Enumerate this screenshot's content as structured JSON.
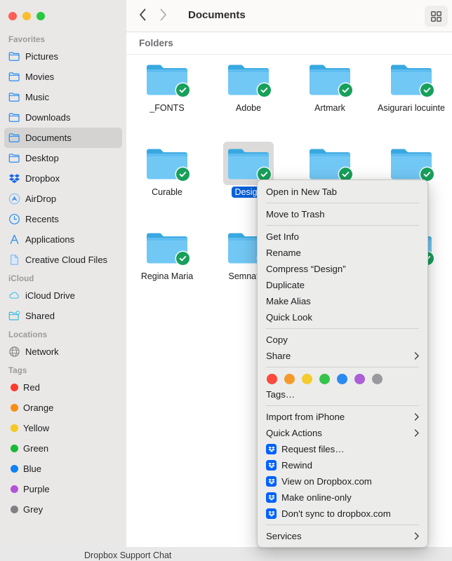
{
  "window": {
    "traffic_lights": [
      "close",
      "minimize",
      "zoom"
    ],
    "toolbar": {
      "back_label": "Back",
      "forward_label": "Forward",
      "title": "Documents",
      "view_button_label": "Icon View"
    },
    "section_header": "Folders"
  },
  "sidebar": {
    "sections": [
      {
        "title": "Favorites",
        "items": [
          {
            "label": "Pictures",
            "icon": "folder-icon",
            "selected": false
          },
          {
            "label": "Movies",
            "icon": "folder-icon",
            "selected": false
          },
          {
            "label": "Music",
            "icon": "folder-icon",
            "selected": false
          },
          {
            "label": "Downloads",
            "icon": "folder-icon",
            "selected": false
          },
          {
            "label": "Documents",
            "icon": "folder-icon",
            "selected": true
          },
          {
            "label": "Desktop",
            "icon": "folder-icon",
            "selected": false
          },
          {
            "label": "Dropbox",
            "icon": "dropbox-icon",
            "selected": false
          },
          {
            "label": "AirDrop",
            "icon": "airdrop-icon",
            "selected": false
          },
          {
            "label": "Recents",
            "icon": "clock-icon",
            "selected": false
          },
          {
            "label": "Applications",
            "icon": "applications-icon",
            "selected": false
          },
          {
            "label": "Creative Cloud Files",
            "icon": "document-icon",
            "selected": false
          }
        ]
      },
      {
        "title": "iCloud",
        "items": [
          {
            "label": "iCloud Drive",
            "icon": "cloud-icon",
            "selected": false
          },
          {
            "label": "Shared",
            "icon": "shared-folder-icon",
            "selected": false
          }
        ]
      },
      {
        "title": "Locations",
        "items": [
          {
            "label": "Network",
            "icon": "globe-icon",
            "selected": false
          }
        ]
      },
      {
        "title": "Tags",
        "items": [
          {
            "label": "Red",
            "icon": "tag-dot",
            "color": "#fc3b2d",
            "selected": false
          },
          {
            "label": "Orange",
            "icon": "tag-dot",
            "color": "#fa8d14",
            "selected": false
          },
          {
            "label": "Yellow",
            "icon": "tag-dot",
            "color": "#f7c81e",
            "selected": false
          },
          {
            "label": "Green",
            "icon": "tag-dot",
            "color": "#16bb35",
            "selected": false
          },
          {
            "label": "Blue",
            "icon": "tag-dot",
            "color": "#1182f5",
            "selected": false
          },
          {
            "label": "Purple",
            "icon": "tag-dot",
            "color": "#b452d8",
            "selected": false
          },
          {
            "label": "Grey",
            "icon": "tag-dot",
            "color": "#808084",
            "selected": false
          }
        ]
      }
    ]
  },
  "folders": [
    {
      "name": "_FONTS",
      "synced": true,
      "selected": false
    },
    {
      "name": "Adobe",
      "synced": true,
      "selected": false
    },
    {
      "name": "Artmark",
      "synced": true,
      "selected": false
    },
    {
      "name": "Asigurari locuinte",
      "synced": true,
      "selected": false
    },
    {
      "name": "Curable",
      "synced": true,
      "selected": false
    },
    {
      "name": "Design",
      "synced": true,
      "selected": true
    },
    {
      "name": "",
      "synced": true,
      "selected": false
    },
    {
      "name": "",
      "synced": true,
      "selected": false
    },
    {
      "name": "Regina Maria",
      "synced": true,
      "selected": false
    },
    {
      "name": "Semnaturi",
      "synced": true,
      "selected": false
    },
    {
      "name": "",
      "synced": true,
      "selected": false
    },
    {
      "name": "",
      "synced": true,
      "selected": false
    }
  ],
  "context_menu": {
    "groups": [
      {
        "items": [
          {
            "label": "Open in New Tab",
            "submenu": false,
            "icon": null
          }
        ]
      },
      {
        "items": [
          {
            "label": "Move to Trash",
            "submenu": false,
            "icon": null
          }
        ]
      },
      {
        "items": [
          {
            "label": "Get Info",
            "submenu": false,
            "icon": null
          },
          {
            "label": "Rename",
            "submenu": false,
            "icon": null
          },
          {
            "label": "Compress “Design”",
            "submenu": false,
            "icon": null
          },
          {
            "label": "Duplicate",
            "submenu": false,
            "icon": null
          },
          {
            "label": "Make Alias",
            "submenu": false,
            "icon": null
          },
          {
            "label": "Quick Look",
            "submenu": false,
            "icon": null
          }
        ]
      },
      {
        "items": [
          {
            "label": "Copy",
            "submenu": false,
            "icon": null
          },
          {
            "label": "Share",
            "submenu": true,
            "icon": null
          }
        ]
      },
      {
        "colors": [
          "#fc4a3b",
          "#f59a2a",
          "#f5cc2e",
          "#35c44b",
          "#2b8af0",
          "#ab5ed6",
          "#9a9a9e"
        ],
        "items": [
          {
            "label": "Tags…",
            "submenu": false,
            "icon": null
          }
        ]
      },
      {
        "items": [
          {
            "label": "Import from iPhone",
            "submenu": true,
            "icon": null
          },
          {
            "label": "Quick Actions",
            "submenu": true,
            "icon": null
          },
          {
            "label": "Request files…",
            "submenu": false,
            "icon": "dropbox-icon"
          },
          {
            "label": "Rewind",
            "submenu": false,
            "icon": "dropbox-icon"
          },
          {
            "label": "View on Dropbox.com",
            "submenu": false,
            "icon": "dropbox-icon"
          },
          {
            "label": "Make online-only",
            "submenu": false,
            "icon": "dropbox-icon"
          },
          {
            "label": "Don't sync to dropbox.com",
            "submenu": false,
            "icon": "dropbox-icon"
          }
        ]
      },
      {
        "items": [
          {
            "label": "Services",
            "submenu": true,
            "icon": null
          }
        ]
      }
    ]
  },
  "desktop": {
    "bottom_label": "Dropbox Support Chat"
  },
  "colors": {
    "sidebar_bg": "#e9e8e7",
    "menu_bg": "#ececeb",
    "selection_blue": "#0a60d8",
    "sync_green": "#17a05a",
    "folder_blue": "#6ec6f5",
    "dropbox_blue": "#0061fe"
  }
}
